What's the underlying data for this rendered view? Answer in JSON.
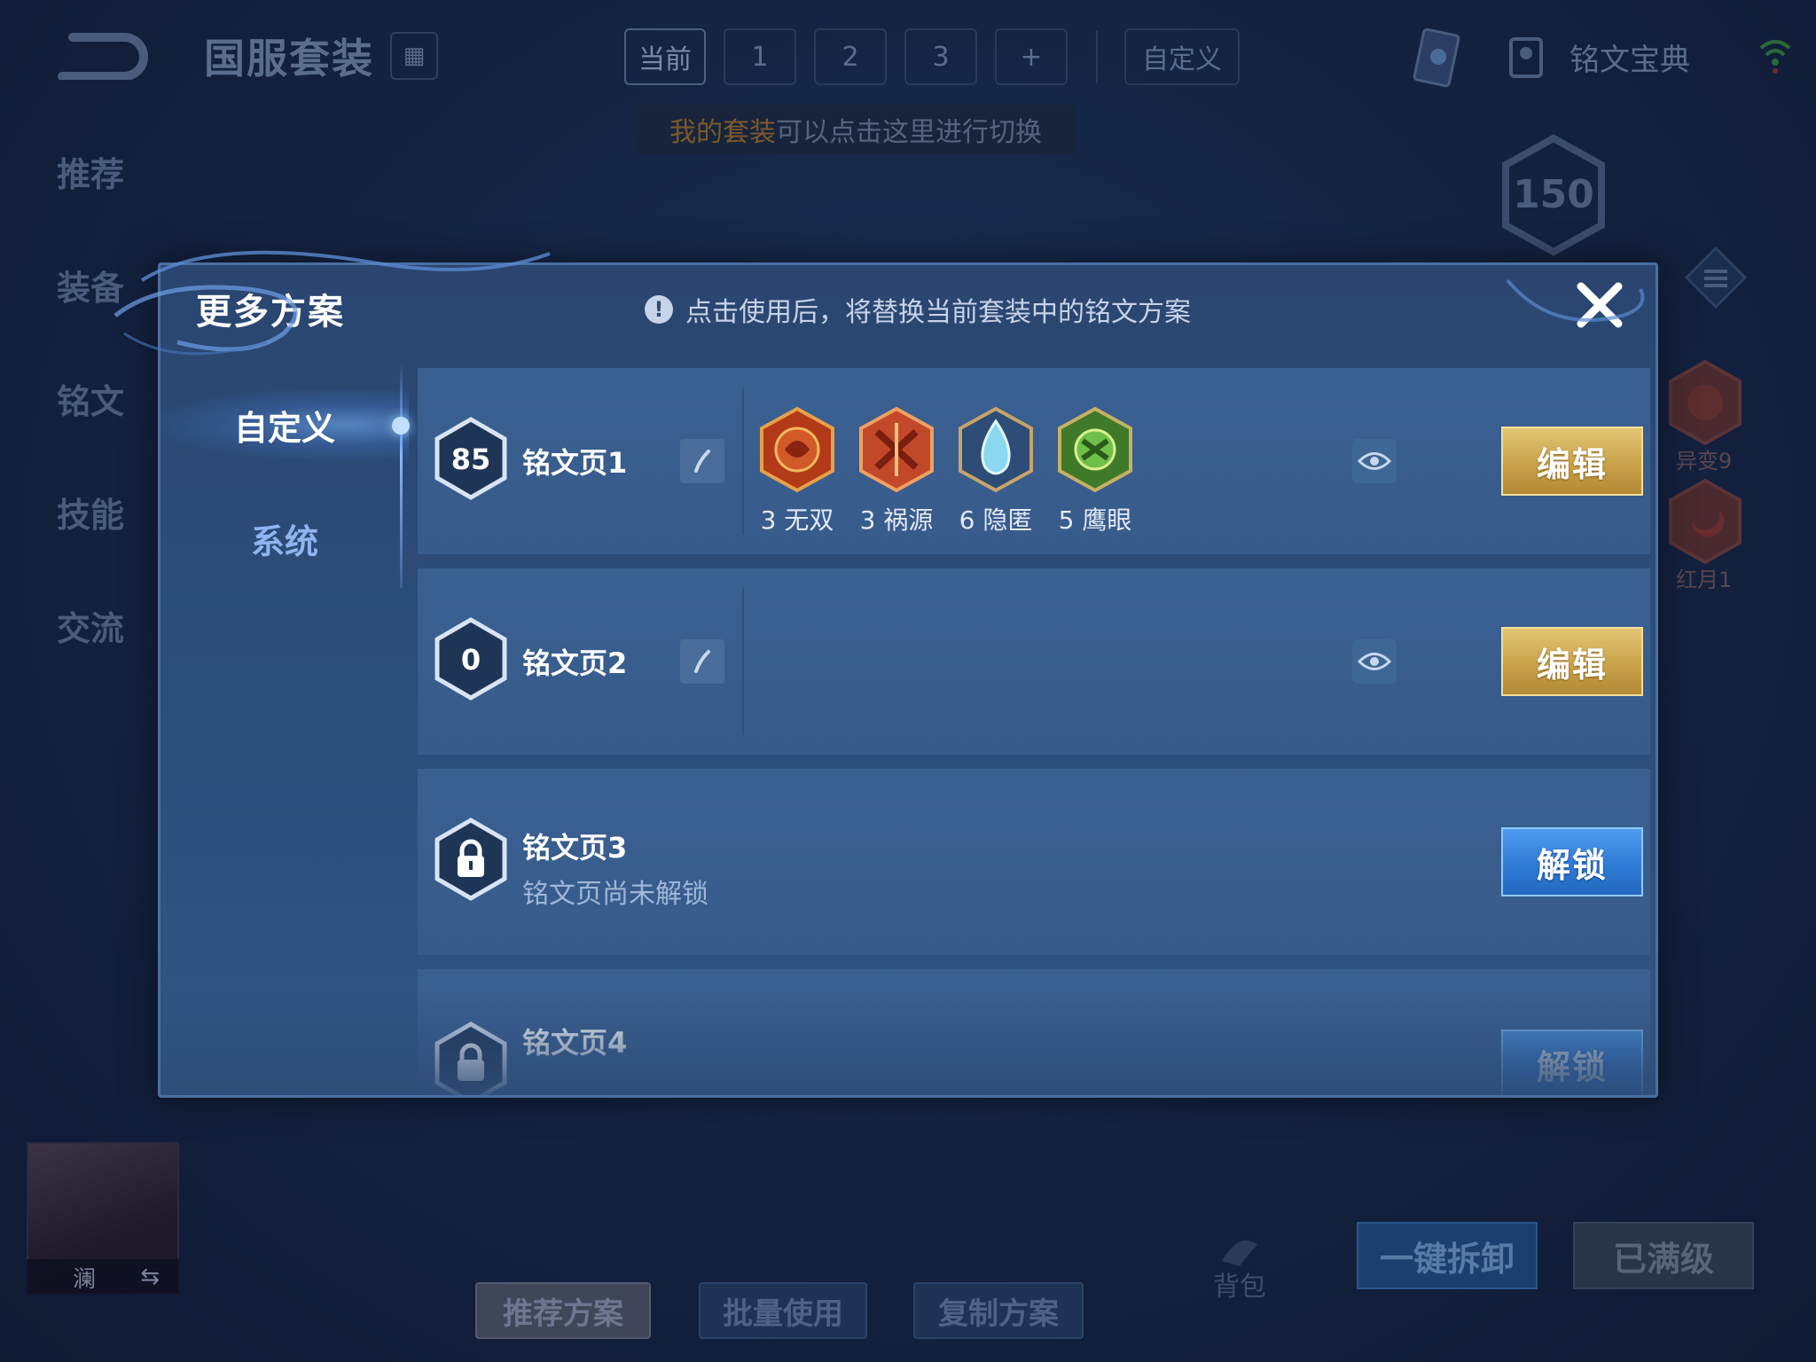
{
  "background": {
    "page_title": "国服套装",
    "top_tabs": [
      "当前",
      "1",
      "2",
      "3",
      "+"
    ],
    "custom_tab": "自定义",
    "hint_highlight": "我的套装",
    "hint_rest": "可以点击这里进行切换",
    "book_label": "铭文宝典",
    "left_nav": [
      "推荐",
      "装备",
      "铭文",
      "技能",
      "交流"
    ],
    "level_badge": "150",
    "side_runes": [
      "异变9",
      "红月1"
    ],
    "hero_name": "澜",
    "bottom_buttons": [
      "推荐方案",
      "批量使用",
      "复制方案"
    ],
    "bag_label": "背包",
    "unload_all": "一键拆卸",
    "maxed": "已满级"
  },
  "modal": {
    "title": "更多方案",
    "notice": "点击使用后，将替换当前套装中的铭文方案",
    "tabs": [
      "自定义",
      "系统"
    ],
    "pages": [
      {
        "level": "85",
        "name": "铭文页1",
        "runes": [
          {
            "label": "3 无双",
            "icon": "wushuang-rune-icon",
            "color": "#c8441e"
          },
          {
            "label": "3 祸源",
            "icon": "huoyuan-rune-icon",
            "color": "#d2532a"
          },
          {
            "label": "6 隐匿",
            "icon": "yinni-rune-icon",
            "color": "#6ec8e8"
          },
          {
            "label": "5 鹰眼",
            "icon": "yingyan-rune-icon",
            "color": "#5aa83a"
          }
        ],
        "action": "编辑"
      },
      {
        "level": "0",
        "name": "铭文页2",
        "runes": [],
        "action": "编辑"
      },
      {
        "name": "铭文页3",
        "status": "铭文页尚未解锁",
        "action": "解锁"
      },
      {
        "name": "铭文页4",
        "action": "解锁"
      }
    ]
  },
  "colors": {
    "edit_gold": "#c9a24a",
    "unlock_blue": "#2f7bd6",
    "panel_blue": "#2d4d7a"
  }
}
